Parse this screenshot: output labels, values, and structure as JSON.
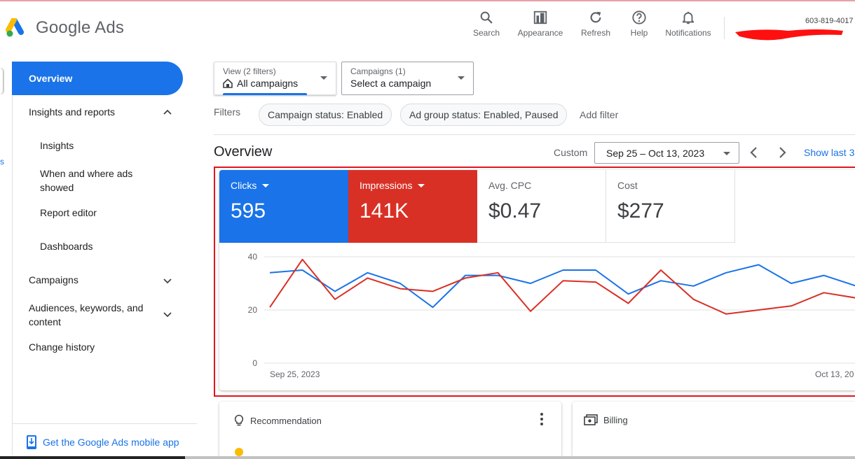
{
  "header": {
    "brand": "Google Ads",
    "actions": [
      {
        "label": "Search",
        "icon": "search-icon"
      },
      {
        "label": "Appearance",
        "icon": "appearance-icon"
      },
      {
        "label": "Refresh",
        "icon": "refresh-icon"
      },
      {
        "label": "Help",
        "icon": "help-icon"
      },
      {
        "label": "Notifications",
        "icon": "bell-icon"
      }
    ],
    "account_id": "603-819-4017"
  },
  "sidebar": {
    "active": "Overview",
    "insights_group": "Insights and reports",
    "insights_items": [
      "Insights",
      "When and where ads showed",
      "Report editor",
      "Dashboards"
    ],
    "campaigns": "Campaigns",
    "audiences": "Audiences, keywords, and content",
    "change_history": "Change history",
    "mobile_app": "Get the Google Ads mobile app"
  },
  "selectors": {
    "view_caption": "View (2 filters)",
    "view_value": "All campaigns",
    "campaigns_caption": "Campaigns (1)",
    "campaigns_value": "Select a campaign"
  },
  "filters": {
    "label": "Filters",
    "chips": [
      "Campaign status: Enabled",
      "Ad group status: Enabled, Paused"
    ],
    "add": "Add filter"
  },
  "overview": {
    "title": "Overview",
    "range_type": "Custom",
    "date_range": "Sep 25 – Oct 13, 2023",
    "show_last": "Show last 3"
  },
  "metrics": [
    {
      "label": "Clicks",
      "value": "595",
      "color": "#1a73e8"
    },
    {
      "label": "Impressions",
      "value": "141K",
      "color": "#d93025"
    },
    {
      "label": "Avg. CPC",
      "value": "$0.47"
    },
    {
      "label": "Cost",
      "value": "$277"
    }
  ],
  "chart_data": {
    "type": "line",
    "y_ticks": [
      "40",
      "20",
      "0"
    ],
    "ylim": [
      0,
      40
    ],
    "x_start_label": "Sep 25, 2023",
    "x_end_label": "Oct 13, 20",
    "x": [
      "Sep 25",
      "Sep 26",
      "Sep 27",
      "Sep 28",
      "Sep 29",
      "Sep 30",
      "Oct 1",
      "Oct 2",
      "Oct 3",
      "Oct 4",
      "Oct 5",
      "Oct 6",
      "Oct 7",
      "Oct 8",
      "Oct 9",
      "Oct 10",
      "Oct 11",
      "Oct 12",
      "Oct 13"
    ],
    "series": [
      {
        "name": "Clicks",
        "color": "#1a73e8",
        "values": [
          34,
          35,
          27,
          34,
          30,
          21,
          33,
          33,
          30,
          35,
          35,
          26,
          31,
          29,
          34,
          37,
          30,
          33,
          29
        ]
      },
      {
        "name": "Impressions",
        "color": "#d93025",
        "values": [
          21,
          39,
          24,
          32,
          28,
          27,
          32,
          34,
          19.5,
          31,
          30.5,
          22.5,
          35,
          24,
          18.5,
          20,
          21.5,
          26.5,
          24.5
        ]
      }
    ]
  },
  "cards": {
    "recommendation": "Recommendation",
    "billing": "Billing"
  }
}
